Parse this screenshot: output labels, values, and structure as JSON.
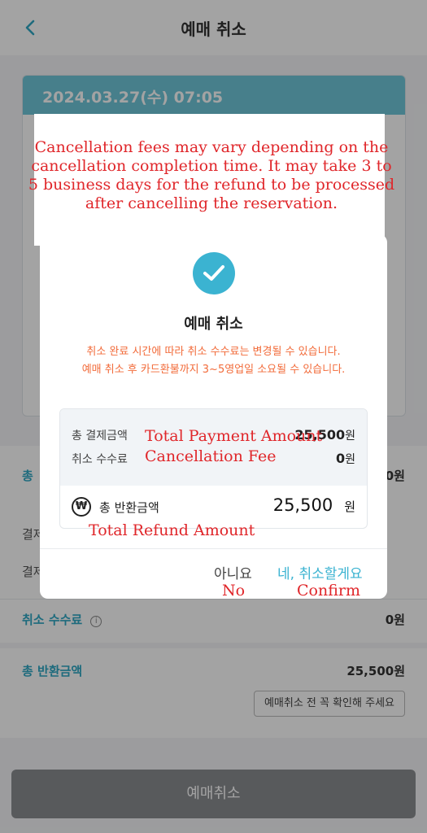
{
  "header": {
    "back_icon": "chevron-left-icon",
    "title": "예매 취소"
  },
  "ticket": {
    "datetime": "2024.03.27(수) 07:05"
  },
  "summary": {
    "total_label_partial": "총 ",
    "total_value_partial": "0원",
    "method_label_1": "결제",
    "method_label_2": "결제",
    "fee_label": "취소 수수료",
    "fee_value": "0원",
    "refund_label": "총 반환금액",
    "refund_value": "25,500원",
    "notice_button": "예매취소 전 꼭 확인해 주세요"
  },
  "bottom_button": "예매취소",
  "modal": {
    "title": "예매 취소",
    "message": "취소 완료 시간에 따라 취소 수수료는 변경될 수 있습니다. 예매 취소 후 카드환불까지 3~5영업일 소요될 수 있습니다.",
    "payment_label": "총 결제금액",
    "payment_value": "25,500",
    "payment_unit": "원",
    "fee_label": "취소 수수료",
    "fee_value": "0",
    "fee_unit": "원",
    "refund_label": "총 반환금액",
    "refund_value": "25,500",
    "refund_unit": "원",
    "no_button": "아니요",
    "confirm_button": "네, 취소할게요"
  },
  "translations": {
    "notice": "Cancellation fees may vary depending on the cancellation completion time. It may take 3 to 5 business days for the refund to be processed after cancelling the reservation.",
    "total_payment": "Total Payment Amount",
    "cancellation_fee": "Cancellation Fee",
    "total_refund": "Total Refund Amount",
    "no": "No",
    "confirm": "Confirm"
  },
  "colors": {
    "accent": "#3bb3d1",
    "warning": "#f26b3a",
    "translation": "#e0262a"
  }
}
